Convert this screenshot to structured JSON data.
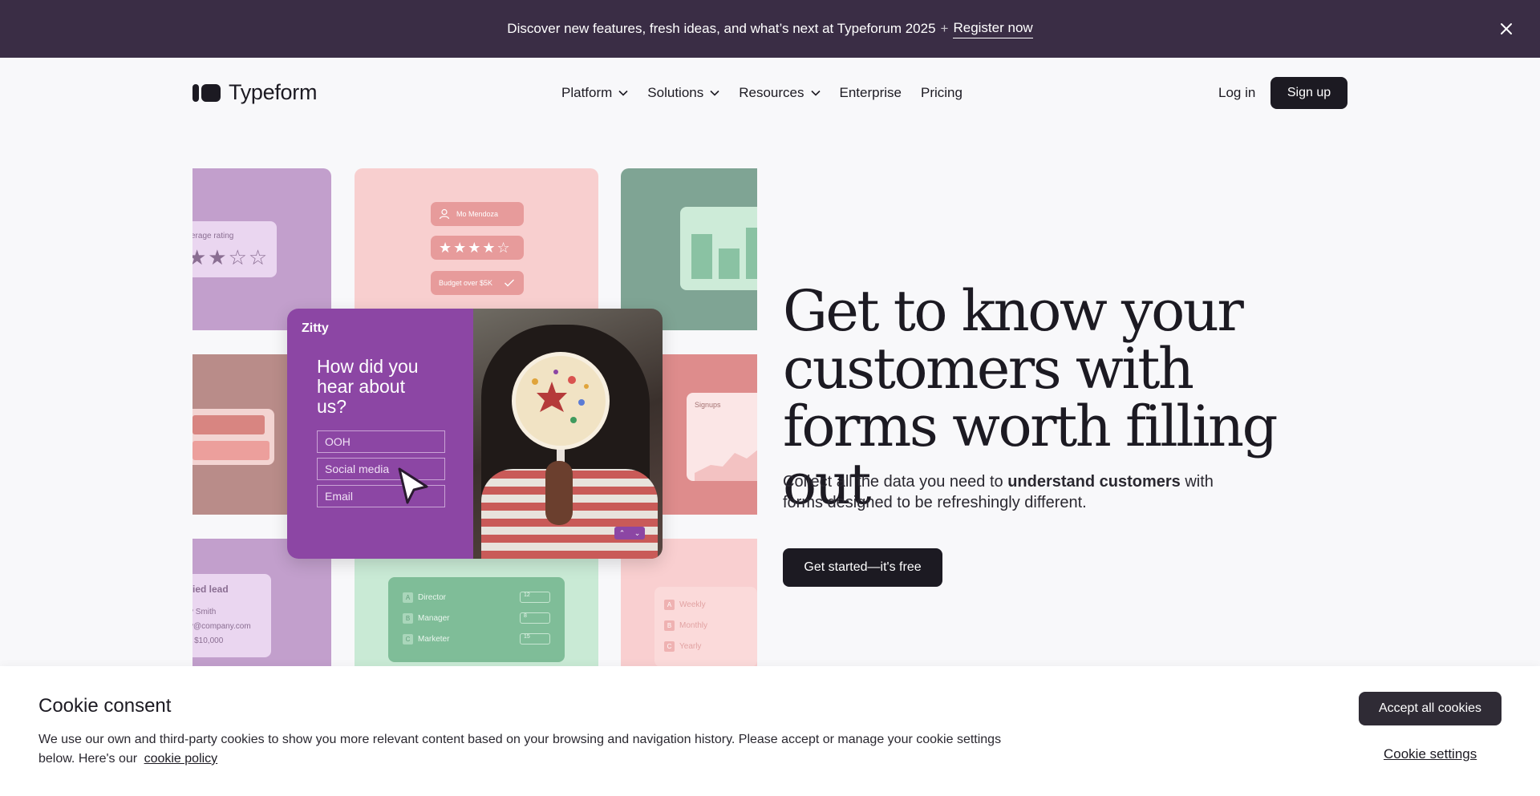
{
  "announcement": {
    "text": "Discover new features, fresh ideas, and what’s next at Typeforum 2025",
    "separator": "+",
    "link": "Register now"
  },
  "header": {
    "logo_text": "Typeform",
    "nav": [
      {
        "label": "Platform",
        "dropdown": true
      },
      {
        "label": "Solutions",
        "dropdown": true
      },
      {
        "label": "Resources",
        "dropdown": true
      },
      {
        "label": "Enterprise",
        "dropdown": false
      },
      {
        "label": "Pricing",
        "dropdown": false
      }
    ],
    "login": "Log in",
    "signup": "Sign up"
  },
  "collage": {
    "rating_label": "erage rating",
    "rating_stars": "★★☆☆",
    "pill_name": "Mo Mendoza",
    "pill_stars": "★★★★☆",
    "pill_budget": "Budget over $5K",
    "signups_label": "Signups",
    "lead_title": "fied lead",
    "lead_lines": [
      "y Smith",
      "y@company.com",
      "- $10,000"
    ],
    "roles": [
      {
        "key": "A",
        "label": "Director",
        "value": "12"
      },
      {
        "key": "B",
        "label": "Manager",
        "value": "8"
      },
      {
        "key": "C",
        "label": "Marketer",
        "value": "15"
      }
    ],
    "frequency": [
      {
        "key": "A",
        "label": "Weekly"
      },
      {
        "key": "B",
        "label": "Monthly"
      },
      {
        "key": "C",
        "label": "Yearly"
      }
    ],
    "form": {
      "brand": "Zitty",
      "question": "How did you hear about us?",
      "options": [
        "OOH",
        "Social media",
        "Email"
      ]
    }
  },
  "hero": {
    "title": "Get to know your customers with forms worth filling out",
    "subtitle_pre": "Collect all the data you need to ",
    "subtitle_bold": "understand customers",
    "subtitle_post": " with forms designed to be refreshingly different.",
    "cta": "Get started—it's free"
  },
  "cookie": {
    "title": "Cookie consent",
    "text": "We use our own and third-party cookies to show you more relevant content based on your browsing and navigation history. Please accept or manage your cookie settings below. Here's our",
    "policy_link": "cookie policy",
    "accept": "Accept all cookies",
    "settings": "Cookie settings"
  }
}
